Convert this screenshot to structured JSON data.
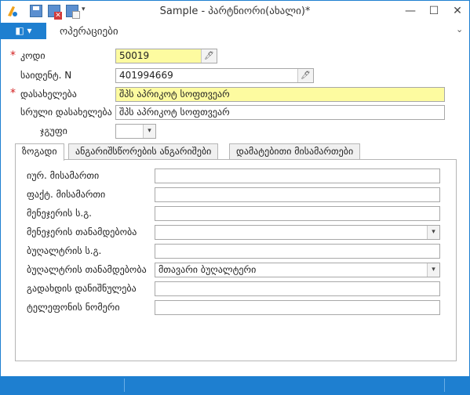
{
  "window": {
    "title": "Sample - პარტნიორი(ახალი)*",
    "min_icon": "—",
    "max_icon": "☐",
    "close_icon": "✕"
  },
  "quick_access": {
    "menu_arrow": "▾"
  },
  "ribbon": {
    "file_label": "◧ ▾",
    "tab_operations": "ოპერაციები",
    "collapse_icon": "⌄"
  },
  "form": {
    "code": {
      "label": "კოდი",
      "value": "50019",
      "required": true
    },
    "tax_id": {
      "label": "საიდენტ. N",
      "value": "401994669"
    },
    "name": {
      "label": "დასახელება",
      "value": "შპს აპრიკოტ სოფთვეარ",
      "required": true
    },
    "full_name": {
      "label": "სრული დასახელება",
      "value": "შპს აპრიკოტ სოფთვეარ"
    },
    "group": {
      "label": "ჯგუფი",
      "value": ""
    },
    "required_mark": "*",
    "edit_icon": "🖊",
    "dropdown_icon": "▾"
  },
  "tabs": [
    {
      "label": "ზოგადი",
      "active": true
    },
    {
      "label": "ანგარიშსწორების ანგარიშები",
      "active": false
    },
    {
      "label": "დამატებითი მისამართები",
      "active": false
    }
  ],
  "general_tab": {
    "legal_address": {
      "label": "იურ. მისამართი",
      "value": ""
    },
    "actual_address": {
      "label": "ფაქტ. მისამართი",
      "value": ""
    },
    "manager_name": {
      "label": "მენეჯერის ს.გ.",
      "value": ""
    },
    "manager_position": {
      "label": "მენეჯერის თანამდებობა",
      "value": ""
    },
    "accountant_name": {
      "label": "ბუღალტრის ს.გ.",
      "value": ""
    },
    "accountant_position": {
      "label": "ბუღალტრის თანამდებობა",
      "value": "მთავარი ბუღალტერი"
    },
    "payer_purpose": {
      "label": "გადახდის დანიშნულება",
      "value": ""
    },
    "phone": {
      "label": "ტელეფონის ნომერი",
      "value": ""
    }
  },
  "colors": {
    "accent": "#1e7fd0",
    "required_field": "#fdfba0",
    "required_mark": "#d32020"
  }
}
